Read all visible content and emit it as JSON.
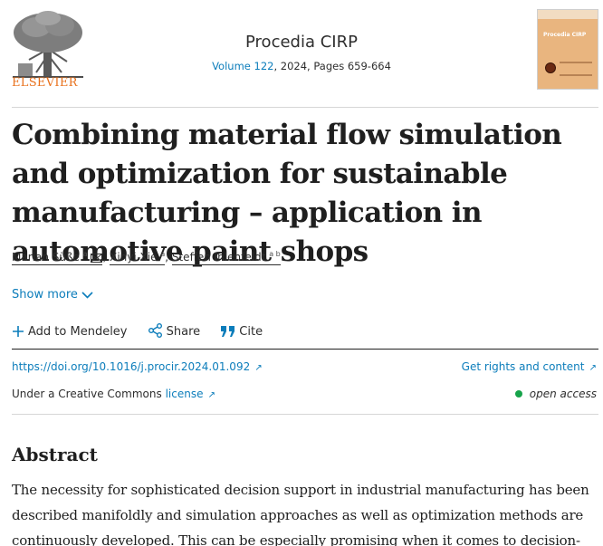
{
  "journal": {
    "publisher": "ELSEVIER",
    "title": "Procedia CIRP",
    "volume_link": "Volume 122",
    "meta_rest": ", 2024, Pages 659-664",
    "cover_title": "Procedia CIRP"
  },
  "article": {
    "title": "Combining material flow simulation and optimization for sustainable manufacturing – application in automotive paint shops",
    "authors": [
      {
        "name": "Marian Süße",
        "sup": "a"
      },
      {
        "name": "Xinyi Xie",
        "sup": "a"
      },
      {
        "name": "Steffen Ihlenfeldt",
        "sup": "a b"
      }
    ],
    "show_more": "Show more"
  },
  "actions": {
    "mendeley": "Add to Mendeley",
    "share": "Share",
    "cite": "Cite"
  },
  "links": {
    "doi": "https://doi.org/10.1016/j.procir.2024.01.092",
    "rights": "Get rights and content",
    "license_prefix": "Under a Creative Commons",
    "license_link": "license",
    "open_access": "open access"
  },
  "abstract": {
    "heading": "Abstract",
    "text": "The necessity for sophisticated decision support in industrial manufacturing has been described manifoldly and simulation approaches as well as optimization methods are continuously developed. This can be especially promising when it comes to decision-"
  },
  "colors": {
    "link": "#0c7dbb",
    "publisher_orange": "#e9711c",
    "open_access_dot": "#16a34a"
  },
  "icons": [
    "elsevier-tree-logo",
    "mail-icon",
    "chevron-down-icon",
    "plus-icon",
    "share-icon",
    "quote-icon",
    "external-link-icon"
  ]
}
